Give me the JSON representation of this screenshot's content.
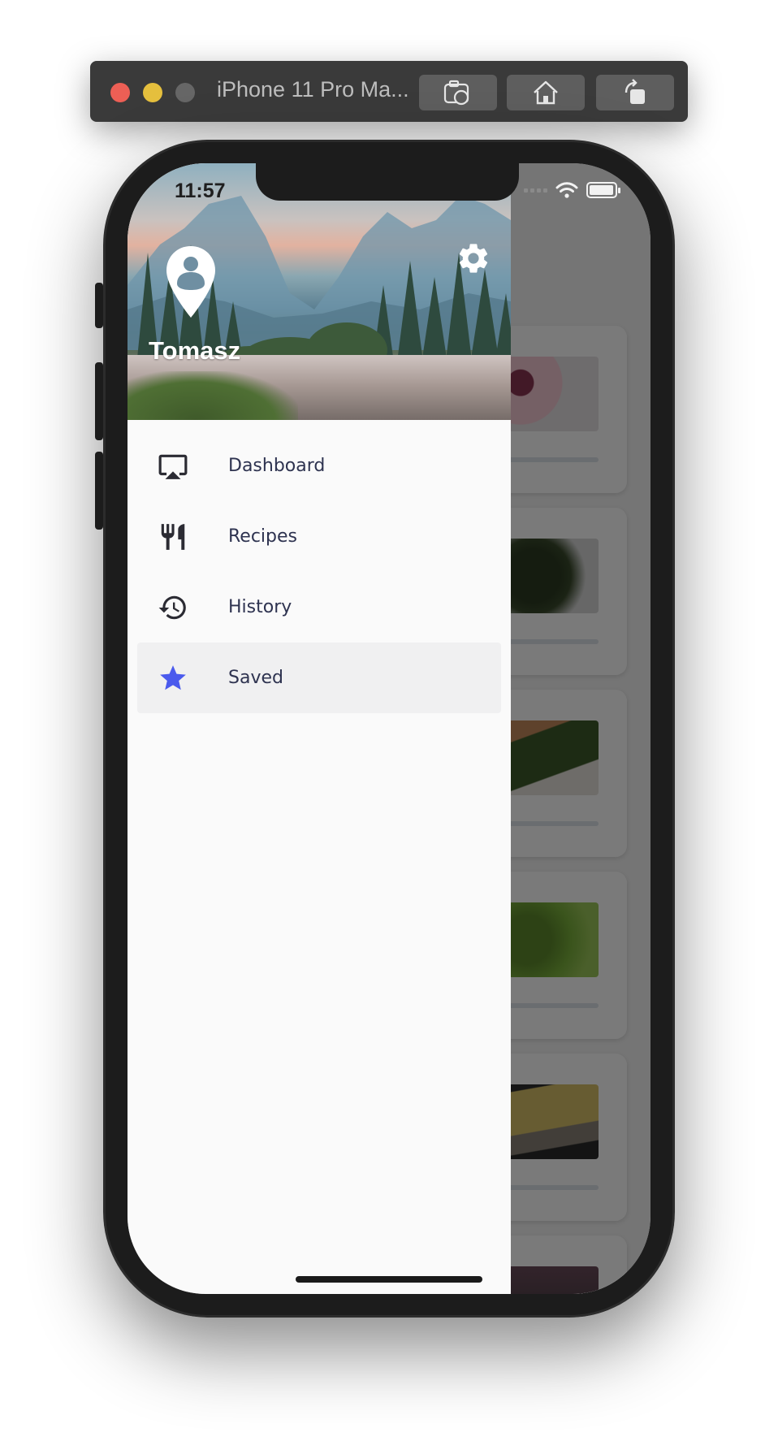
{
  "titlebar": {
    "device_name": "iPhone 11 Pro Ma...",
    "traffic_lights": [
      "#ed5f55",
      "#e5bf3d",
      "#666666"
    ],
    "buttons": [
      {
        "name": "screenshot-button",
        "icon": "camera-icon"
      },
      {
        "name": "home-button",
        "icon": "home-icon"
      },
      {
        "name": "rotate-button",
        "icon": "rotate-icon"
      }
    ]
  },
  "status_bar": {
    "time": "11:57"
  },
  "drawer": {
    "header": {
      "username": "Tomasz",
      "avatar_icon": "location-pin-user-icon",
      "settings_icon": "gear-icon"
    },
    "items": [
      {
        "label": "Dashboard",
        "icon": "airplay-icon",
        "selected": false
      },
      {
        "label": "Recipes",
        "icon": "fork-knife-icon",
        "selected": false
      },
      {
        "label": "History",
        "icon": "history-icon",
        "selected": false
      },
      {
        "label": "Saved",
        "icon": "star-icon",
        "selected": true
      }
    ],
    "accent_color": "#4a5aed",
    "text_color": "#2e3350"
  }
}
